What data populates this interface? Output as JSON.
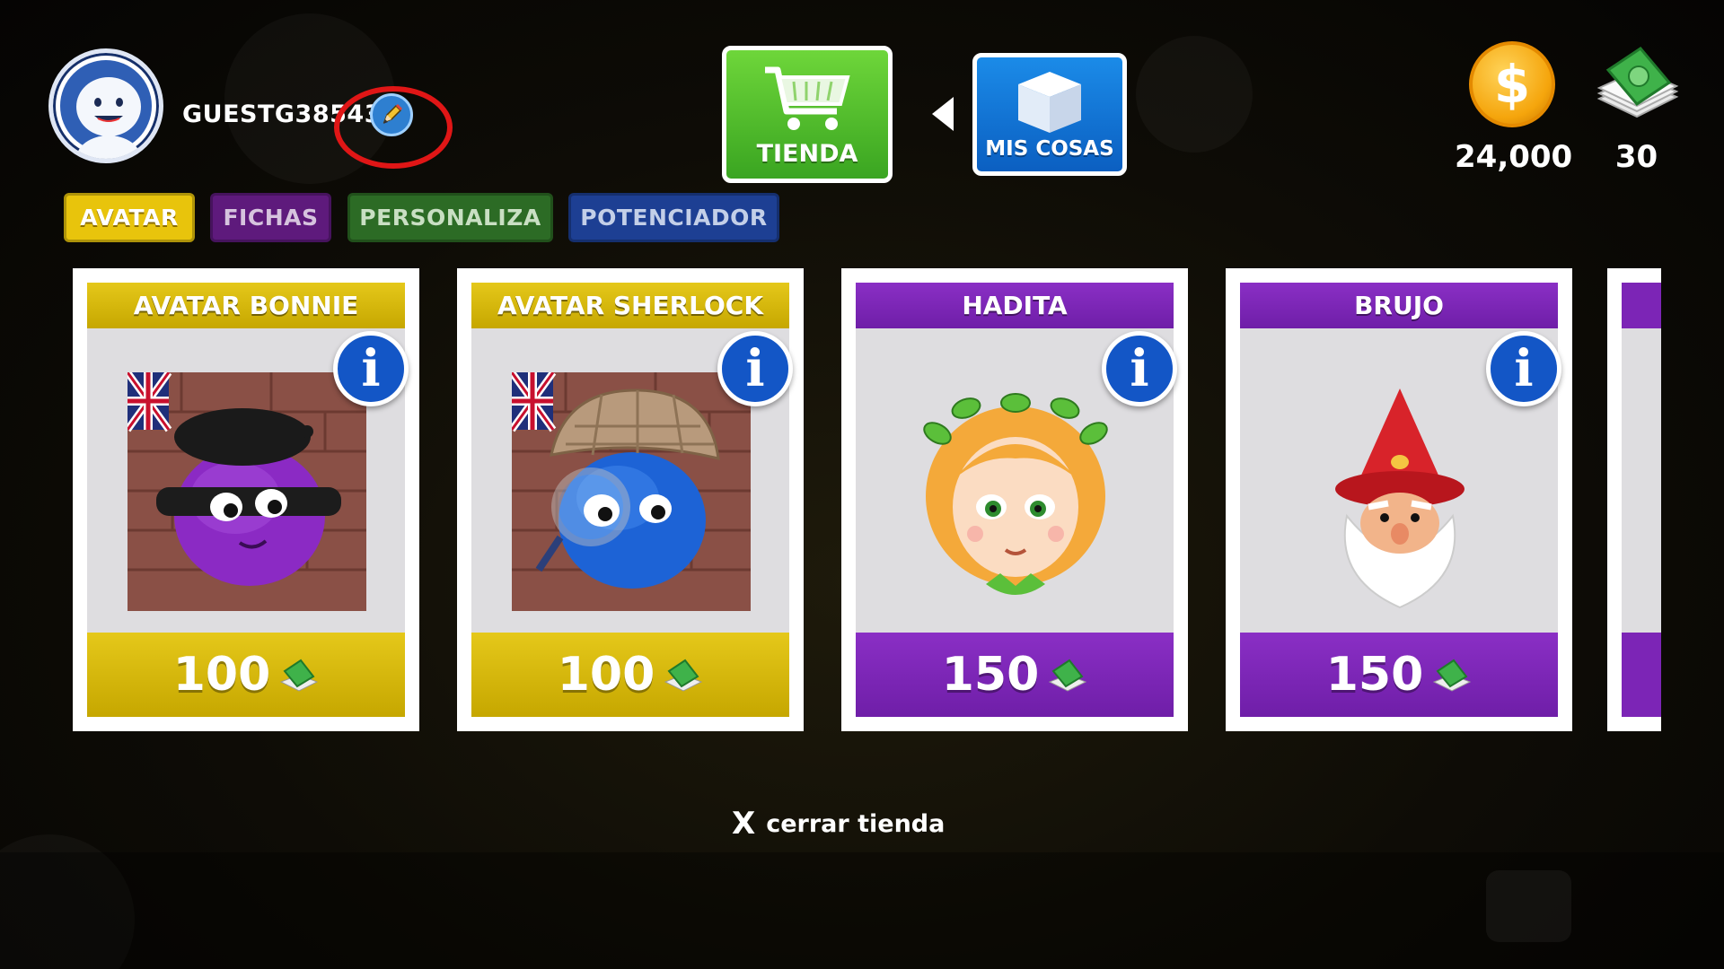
{
  "player": {
    "username": "GUESTG385438",
    "avatar_icon": "robot-avatar-icon",
    "edit_icon": "pencil-icon"
  },
  "nav": {
    "shop_label": "TIENDA",
    "my_stuff_label": "MIS COSAS"
  },
  "currency": {
    "coins": "24,000",
    "cash": "30",
    "coin_symbol": "$"
  },
  "tabs": [
    {
      "label": "AVATAR",
      "active": true
    },
    {
      "label": "FICHAS",
      "active": false
    },
    {
      "label": "PERSONALIZA",
      "active": false
    },
    {
      "label": "POTENCIADOR",
      "active": false
    }
  ],
  "items": [
    {
      "title": "AVATAR BONNIE",
      "price": "100",
      "theme": "gold",
      "portrait": "purple-ball-beret-mask"
    },
    {
      "title": "AVATAR SHERLOCK",
      "price": "100",
      "theme": "gold",
      "portrait": "blue-ball-deerstalker-magnifier"
    },
    {
      "title": "HADITA",
      "price": "150",
      "theme": "purple",
      "portrait": "fairy-girl-leaf-crown"
    },
    {
      "title": "BRUJO",
      "price": "150",
      "theme": "purple",
      "portrait": "wizard-red-hat-beard"
    }
  ],
  "info_label": "i",
  "close_shop": {
    "x_label": "X",
    "label": "cerrar tienda"
  },
  "colors": {
    "gold": "#d6b90e",
    "purple": "#7c25b6",
    "shop_green": "#4cbf2a",
    "my_stuff_blue": "#1275d6",
    "info_blue": "#1356c6",
    "highlight_red": "#e01616"
  }
}
